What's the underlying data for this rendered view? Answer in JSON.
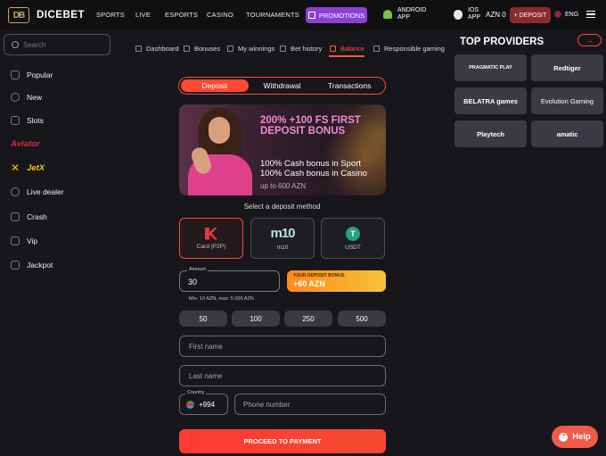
{
  "header": {
    "logo_mark": "DB",
    "logo_text": "DICEBET",
    "nav": [
      "SPORTS",
      "LIVE",
      "ESPORTS",
      "CASINO",
      "TOURNAMENTS"
    ],
    "promotions": "PROMOTIONS",
    "android_l1": "ANDROID",
    "android_l2": "APP",
    "ios_l1": "IOS",
    "ios_l2": "APP",
    "balance": "AZN 0",
    "deposit": "+ DEPOSIT",
    "lang": "ENG"
  },
  "sidebar": {
    "search_placeholder": "Search",
    "items": [
      "Popular",
      "New",
      "Slots",
      "Aviator",
      "JetX",
      "Live dealer",
      "Crash",
      "Vip",
      "Jackpot"
    ]
  },
  "subnav": [
    "Dashboard",
    "Bonuses",
    "My winnings",
    "Bet history",
    "Balance",
    "Responsible gaming"
  ],
  "tabs": [
    "Deposit",
    "Withdrawal",
    "Transactions"
  ],
  "banner": {
    "title": "200% +100 FS FIRST DEPOSIT BONUS",
    "line1": "100% Cash bonus in Sport",
    "line2": "100% Cash bonus in Casino",
    "sub": "up to 600 AZN"
  },
  "deposit_form": {
    "method_title": "Select a deposit method",
    "methods": [
      "Card (P2P)",
      "m10",
      "USDT"
    ],
    "m10_logo": "m10",
    "usdt_symbol": "T",
    "amount_label": "Amount",
    "amount_value": "30",
    "amount_hint": "Min: 10 AZN, max: 5 000 AZN",
    "bonus_caption": "YOUR DEPOSIT BONUS:",
    "bonus_value": "+60 AZN",
    "quick_amounts": [
      "50",
      "100",
      "250",
      "500"
    ],
    "first_name_placeholder": "First name",
    "last_name_placeholder": "Last name",
    "country_label": "Country",
    "country_code": "+994",
    "phone_placeholder": "Phone number",
    "proceed": "PROCEED TO PAYMENT"
  },
  "providers": {
    "title": "TOP PROVIDERS",
    "arrow": "→",
    "items": [
      "PRAGMATIC PLAY",
      "Redtiger",
      "BELATRA games",
      "Evolution Gaming",
      "Playtech",
      "amatic"
    ]
  },
  "help": "Help",
  "help_icon": "?",
  "colors": {
    "accent": "#ff4a33",
    "promo": "#8a3fd6",
    "bonus": "#f4c33a",
    "bg": "#16161b"
  }
}
